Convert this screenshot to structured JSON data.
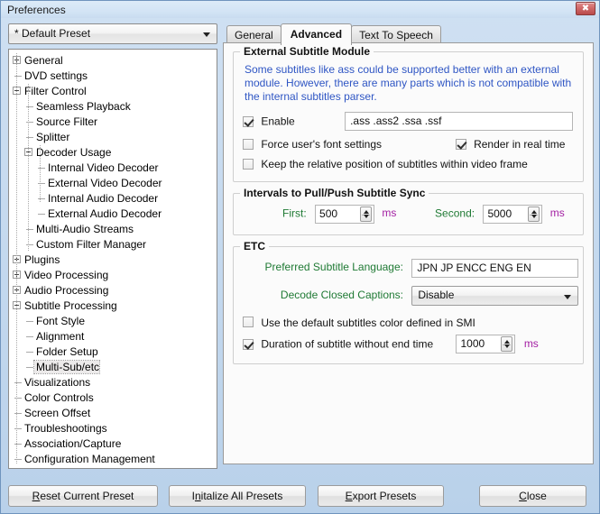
{
  "window": {
    "title": "Preferences",
    "close_icon": "close-icon",
    "close_glyph": "✖"
  },
  "preset": {
    "selected": "* Default Preset",
    "arrow_icon": "chevron-down-icon"
  },
  "tree": {
    "items": [
      {
        "label": "General",
        "indent": 0,
        "marker": "plus"
      },
      {
        "label": "DVD settings",
        "indent": 0,
        "marker": "dash"
      },
      {
        "label": "Filter Control",
        "indent": 0,
        "marker": "minus"
      },
      {
        "label": "Seamless Playback",
        "indent": 1,
        "marker": "dash"
      },
      {
        "label": "Source Filter",
        "indent": 1,
        "marker": "dash"
      },
      {
        "label": "Splitter",
        "indent": 1,
        "marker": "dash"
      },
      {
        "label": "Decoder Usage",
        "indent": 1,
        "marker": "minus"
      },
      {
        "label": "Internal Video Decoder",
        "indent": 2,
        "marker": "dash"
      },
      {
        "label": "External Video Decoder",
        "indent": 2,
        "marker": "dash"
      },
      {
        "label": "Internal Audio Decoder",
        "indent": 2,
        "marker": "dash"
      },
      {
        "label": "External Audio Decoder",
        "indent": 2,
        "marker": "dash"
      },
      {
        "label": "Multi-Audio Streams",
        "indent": 1,
        "marker": "dash"
      },
      {
        "label": "Custom Filter Manager",
        "indent": 1,
        "marker": "dash"
      },
      {
        "label": "Plugins",
        "indent": 0,
        "marker": "plus"
      },
      {
        "label": "Video Processing",
        "indent": 0,
        "marker": "plus"
      },
      {
        "label": "Audio Processing",
        "indent": 0,
        "marker": "plus"
      },
      {
        "label": "Subtitle Processing",
        "indent": 0,
        "marker": "minus"
      },
      {
        "label": "Font Style",
        "indent": 1,
        "marker": "dash"
      },
      {
        "label": "Alignment",
        "indent": 1,
        "marker": "dash"
      },
      {
        "label": "Folder Setup",
        "indent": 1,
        "marker": "dash"
      },
      {
        "label": "Multi-Sub/etc",
        "indent": 1,
        "marker": "dash",
        "selected": true
      },
      {
        "label": "Visualizations",
        "indent": 0,
        "marker": "dash"
      },
      {
        "label": "Color Controls",
        "indent": 0,
        "marker": "dash"
      },
      {
        "label": "Screen Offset",
        "indent": 0,
        "marker": "dash"
      },
      {
        "label": "Troubleshootings",
        "indent": 0,
        "marker": "dash"
      },
      {
        "label": "Association/Capture",
        "indent": 0,
        "marker": "dash"
      },
      {
        "label": "Configuration Management",
        "indent": 0,
        "marker": "dash"
      }
    ]
  },
  "tabs": [
    {
      "label": "General",
      "active": false
    },
    {
      "label": "Advanced",
      "active": true
    },
    {
      "label": "Text To Speech",
      "active": false
    }
  ],
  "external_subtitle_module": {
    "legend": "External Subtitle Module",
    "description": "Some subtitles like ass could be supported better with an external module. However, there are many parts which is not compatible with the internal subtitles parser.",
    "enable_label": "Enable",
    "enable_checked": true,
    "extensions_value": ".ass .ass2 .ssa .ssf",
    "force_font_label": "Force user's font settings",
    "force_font_checked": false,
    "render_realtime_label": "Render in real time",
    "render_realtime_checked": true,
    "keep_relative_label": "Keep the relative position of subtitles within video frame",
    "keep_relative_checked": false
  },
  "intervals": {
    "legend": "Intervals to Pull/Push Subtitle Sync",
    "first_label": "First:",
    "first_value": "500",
    "first_unit": "ms",
    "second_label": "Second:",
    "second_value": "5000",
    "second_unit": "ms"
  },
  "etc": {
    "legend": "ETC",
    "preferred_language_label": "Preferred Subtitle Language:",
    "preferred_language_value": "JPN JP ENCC ENG EN",
    "decode_cc_label": "Decode Closed Captions:",
    "decode_cc_value": "Disable",
    "default_color_label": "Use the default subtitles color defined in SMI",
    "default_color_checked": false,
    "duration_label": "Duration of subtitle without end time",
    "duration_checked": true,
    "duration_value": "1000",
    "duration_unit": "ms"
  },
  "buttons": {
    "reset": {
      "pre": "",
      "key": "R",
      "post": "eset Current Preset"
    },
    "initialize": {
      "pre": "I",
      "key": "n",
      "post": "italize All Presets"
    },
    "export": {
      "pre": "",
      "key": "E",
      "post": "xport Presets"
    },
    "close": {
      "pre": "",
      "key": "C",
      "post": "lose"
    }
  },
  "colors": {
    "description_text": "#2f56c4",
    "field_label": "#1f7a34",
    "unit_text": "#a31fa3",
    "window_chrome": "#c3d8ee",
    "close_button": "#b94a4a"
  }
}
